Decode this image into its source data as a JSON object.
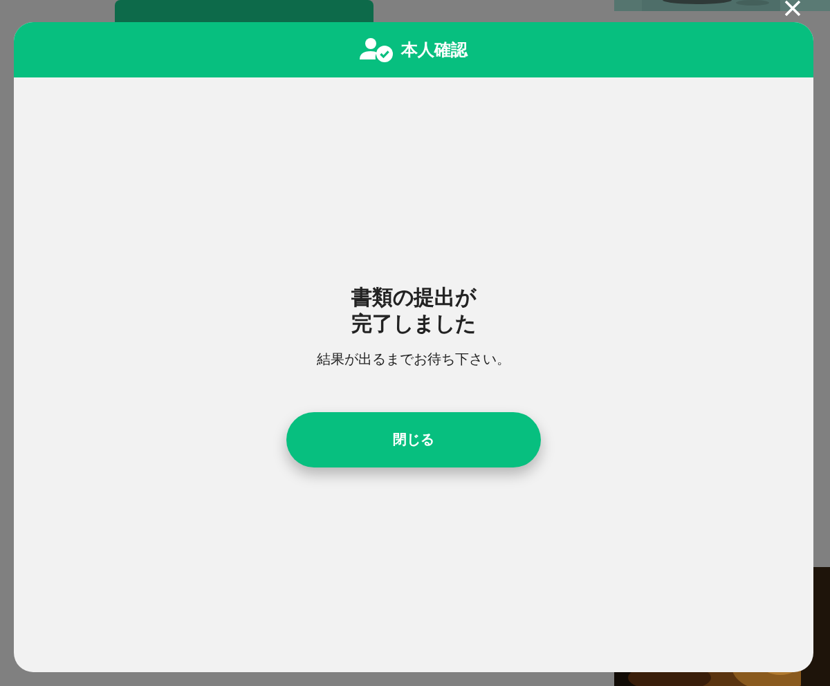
{
  "modal": {
    "title": "本人確認",
    "heading": "書類の提出が完了しました",
    "message": "結果が出るまでお待ち下さい。",
    "button": "閉じる"
  }
}
